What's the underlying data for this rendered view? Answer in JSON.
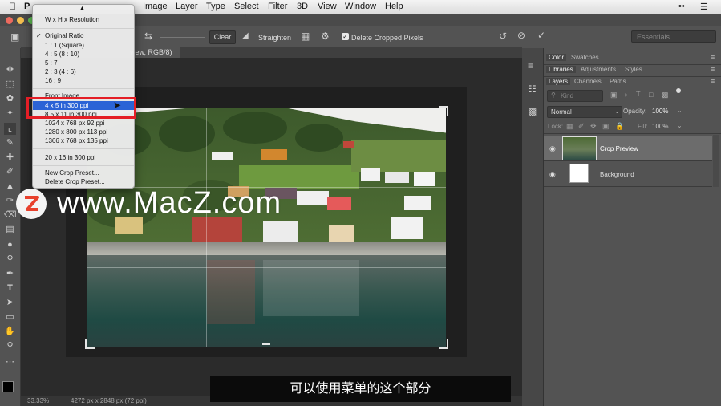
{
  "menubar": {
    "app": "P",
    "items": [
      "Image",
      "Layer",
      "Type",
      "Select",
      "Filter",
      "3D",
      "View",
      "Window",
      "Help"
    ]
  },
  "options_bar": {
    "clear_label": "Clear",
    "straighten_label": "Straighten",
    "delete_cropped_label": "Delete Cropped Pixels",
    "delete_cropped_checked": true,
    "workspace": "Essentials"
  },
  "document": {
    "tab_title": "view, RGB/8)",
    "zoom": "33.33%",
    "doc_info": "4272 px x 2848 px (72 ppi)"
  },
  "crop_menu": {
    "header": "W x H x Resolution",
    "ratios": [
      {
        "label": "Original Ratio",
        "checked": true
      },
      {
        "label": "1 : 1 (Square)"
      },
      {
        "label": "4 : 5 (8 : 10)"
      },
      {
        "label": "5 : 7"
      },
      {
        "label": "2 : 3 (4 : 6)"
      },
      {
        "label": "16 : 9"
      }
    ],
    "front_image": "Front Image",
    "presets": [
      {
        "label": "4 x 5 in 300 ppi",
        "selected": true
      },
      {
        "label": "8.5 x 11 in 300 ppi"
      },
      {
        "label": "1024 x 768 px 92 ppi"
      },
      {
        "label": "1280 x 800 px 113 ppi"
      },
      {
        "label": "1366 x 768 px 135 ppi"
      }
    ],
    "extra": "20 x 16 in 300 ppi",
    "new_preset": "New Crop Preset...",
    "delete_preset": "Delete Crop Preset..."
  },
  "panels": {
    "top_tabs": [
      "Color",
      "Swatches"
    ],
    "mid_tabs": [
      "Libraries",
      "Adjustments",
      "Styles"
    ],
    "layer_tabs": [
      "Layers",
      "Channels",
      "Paths"
    ],
    "kind_placeholder": "Kind",
    "blend_mode": "Normal",
    "opacity_label": "Opacity:",
    "opacity_value": "100%",
    "lock_label": "Lock:",
    "fill_label": "Fill:",
    "fill_value": "100%",
    "layers": [
      {
        "name": "Crop Preview"
      },
      {
        "name": "Background"
      }
    ]
  },
  "watermark": "www.MacZ.com",
  "subtitle": "可以使用菜单的这个部分",
  "colors": {
    "menu_selection": "#2b63d6",
    "highlight_box": "#e41e26",
    "panel_bg": "#535353",
    "canvas_bg": "#2b2b2b"
  }
}
